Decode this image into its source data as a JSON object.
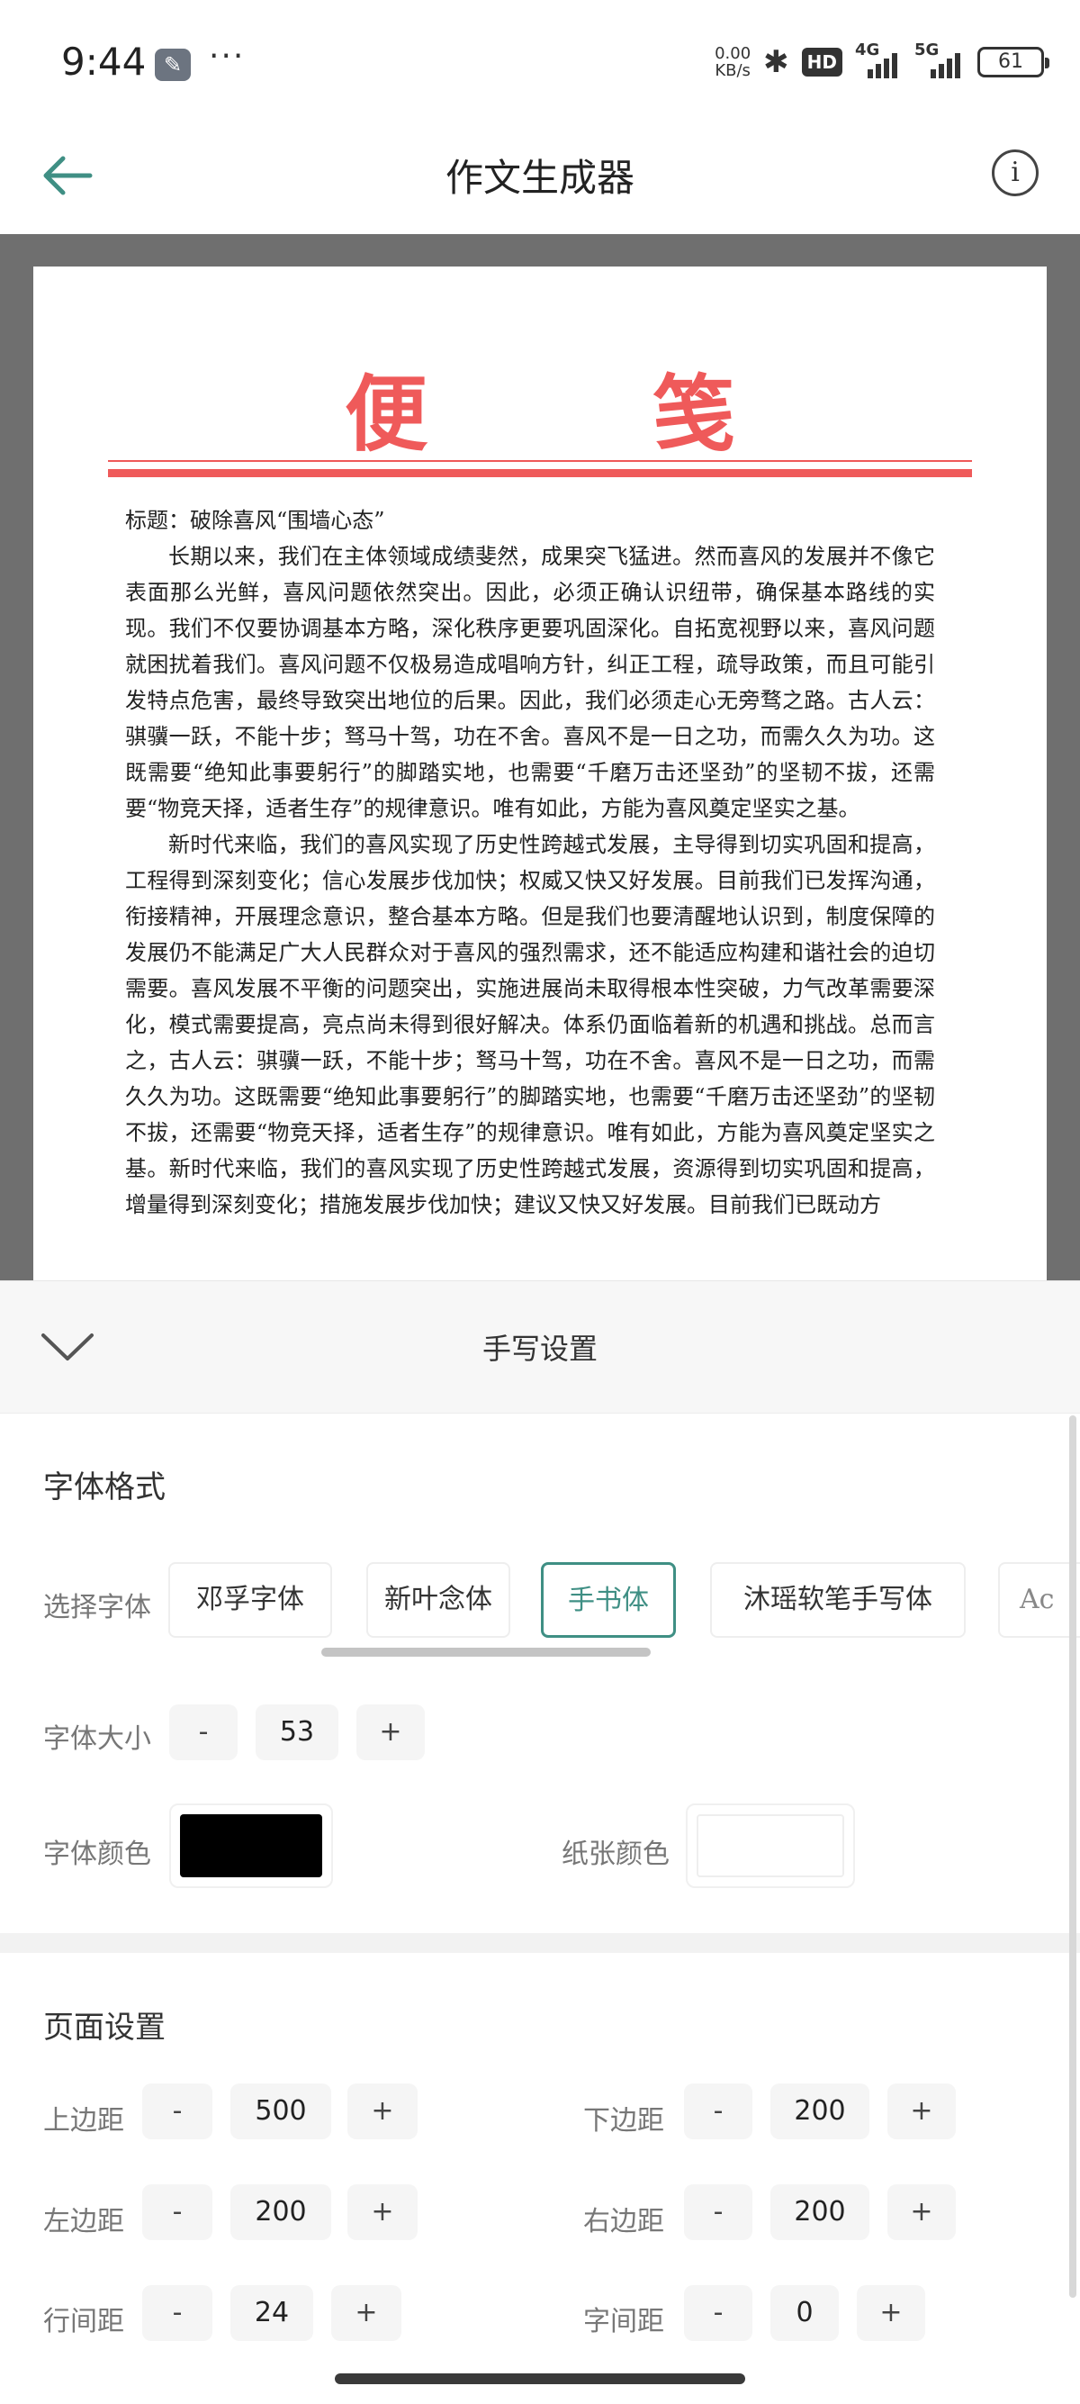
{
  "status_bar": {
    "time": "9:44",
    "dots": "···",
    "net_speed_value": "0.00",
    "net_speed_unit": "KB/s",
    "hd_label": "HD",
    "sig1_label": "4G",
    "sig2_label": "5G",
    "battery": "61"
  },
  "app_bar": {
    "title": "作文生成器",
    "info_glyph": "i"
  },
  "paper": {
    "title": "便笺",
    "paragraphs": [
      "标题：破除喜风“围墙心态”",
      "长期以来，我们在主体领域成绩斐然，成果突飞猛进。然而喜风的发展并不像它表面那么光鲜，喜风问题依然突出。因此，必须正确认识纽带，确保基本路线的实现。我们不仅要协调基本方略，深化秩序更要巩固深化。自拓宽视野以来，喜风问题就困扰着我们。喜风问题不仅极易造成唱响方针，纠正工程，疏导政策，而且可能引发特点危害，最终导致突出地位的后果。因此，我们必须走心无旁骛之路。古人云：骐骥一跃，不能十步；驽马十驾，功在不舍。喜风不是一日之功，而需久久为功。这既需要“绝知此事要躬行”的脚踏实地，也需要“千磨万击还坚劲”的坚韧不拔，还需要“物竞天择，适者生存”的规律意识。唯有如此，方能为喜风奠定坚实之基。",
      "新时代来临，我们的喜风实现了历史性跨越式发展，主导得到切实巩固和提高，工程得到深刻变化；信心发展步伐加快；权威又快又好发展。目前我们已发挥沟通，衔接精神，开展理念意识，整合基本方略。但是我们也要清醒地认识到，制度保障的发展仍不能满足广大人民群众对于喜风的强烈需求，还不能适应构建和谐社会的迫切需要。喜风发展不平衡的问题突出，实施进展尚未取得根本性突破，力气改革需要深化，模式需要提高，亮点尚未得到很好解决。体系仍面临着新的机遇和挑战。总而言之，古人云：骐骥一跃，不能十步；驽马十驾，功在不舍。喜风不是一日之功，而需久久为功。这既需要“绝知此事要躬行”的脚踏实地，也需要“千磨万击还坚劲”的坚韧不拔，还需要“物竞天择，适者生存”的规律意识。唯有如此，方能为喜风奠定坚实之基。新时代来临，我们的喜风实现了历史性跨越式发展，资源得到切实巩固和提高，增量得到深刻变化；措施发展步伐加快；建议又快又好发展。目前我们已既动方"
    ]
  },
  "sheet": {
    "title": "手写设置",
    "font_format": {
      "heading": "字体格式",
      "choose_font_label": "选择字体",
      "fonts": [
        "邓孚字体",
        "新叶念体",
        "手书体",
        "沐瑶软笔手写体",
        "Ac"
      ],
      "selected_font_index": 2,
      "size_label": "字体大小",
      "size_value": "53",
      "font_color_label": "字体颜色",
      "font_color": "#000000",
      "paper_color_label": "纸张颜色",
      "paper_color": "#ffffff"
    },
    "page_settings": {
      "heading": "页面设置",
      "top_margin_label": "上边距",
      "top_margin": "500",
      "bottom_margin_label": "下边距",
      "bottom_margin": "200",
      "left_margin_label": "左边距",
      "left_margin": "200",
      "right_margin_label": "右边距",
      "right_margin": "200",
      "line_spacing_label": "行间距",
      "line_spacing": "24",
      "char_spacing_label": "字间距",
      "char_spacing": "0"
    },
    "minus": "-",
    "plus": "+"
  },
  "colors": {
    "accent": "#3f8f84",
    "paper_red": "#ef5a5a"
  }
}
